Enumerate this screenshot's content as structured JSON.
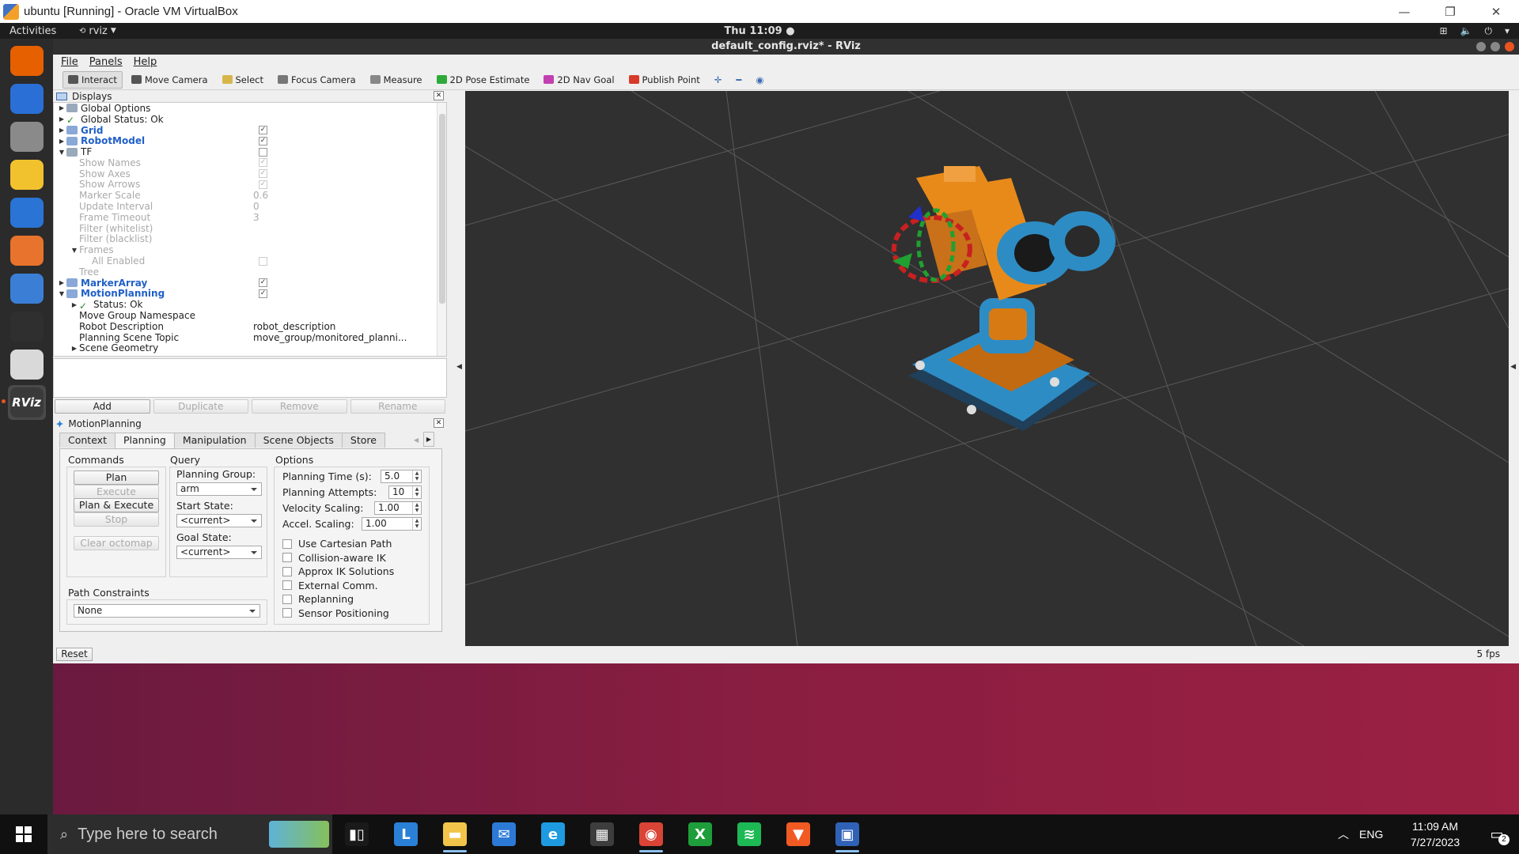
{
  "vbox": {
    "title": "ubuntu [Running] - Oracle VM VirtualBox",
    "minimize": "—",
    "restore": "❐",
    "close": "✕"
  },
  "ubuntu_bar": {
    "activities": "Activities",
    "app_name": "rviz",
    "clock": "Thu 11:09 ●"
  },
  "dock": {
    "items": [
      {
        "name": "firefox",
        "color": "#e66000"
      },
      {
        "name": "thunderbird",
        "color": "#2a6fd6"
      },
      {
        "name": "files",
        "color": "#8a8a8a"
      },
      {
        "name": "rhythmbox",
        "color": "#f2c12e"
      },
      {
        "name": "libreoffice-writer",
        "color": "#2a74d6"
      },
      {
        "name": "software",
        "color": "#e8732c"
      },
      {
        "name": "help",
        "color": "#3a7fd5"
      },
      {
        "name": "terminal",
        "color": "#2f2f2f"
      },
      {
        "name": "text-editor",
        "color": "#d9d9d9"
      },
      {
        "name": "rviz",
        "color": "#3a3a3a",
        "label": "RViz"
      }
    ]
  },
  "rviz": {
    "title": "default_config.rviz* - RViz",
    "menu": [
      "File",
      "Panels",
      "Help"
    ],
    "tools": [
      {
        "label": "Interact",
        "active": true,
        "color": "#555"
      },
      {
        "label": "Move Camera",
        "active": false,
        "color": "#555"
      },
      {
        "label": "Select",
        "active": false,
        "color": "#d6b64b"
      },
      {
        "label": "Focus Camera",
        "active": false,
        "color": "#777"
      },
      {
        "label": "Measure",
        "active": false,
        "color": "#888"
      },
      {
        "label": "2D Pose Estimate",
        "active": false,
        "color": "#2eaa3a"
      },
      {
        "label": "2D Nav Goal",
        "active": false,
        "color": "#c23fb0"
      },
      {
        "label": "Publish Point",
        "active": false,
        "color": "#d83a2a"
      }
    ],
    "displays": {
      "title": "Displays",
      "rows": [
        {
          "label": "Global Options",
          "arrow": "▶",
          "indent": 0,
          "style": "",
          "val": "",
          "check": null
        },
        {
          "label": "Global Status: Ok",
          "arrow": "▶",
          "indent": 0,
          "style": "",
          "val": "",
          "check": null,
          "icon": "✓"
        },
        {
          "label": "Grid",
          "arrow": "▶",
          "indent": 0,
          "style": "blue",
          "val": "",
          "check": "✓"
        },
        {
          "label": "RobotModel",
          "arrow": "▶",
          "indent": 0,
          "style": "blue",
          "val": "",
          "check": "✓"
        },
        {
          "label": "TF",
          "arrow": "▼",
          "indent": 0,
          "style": "",
          "val": "",
          "check": ""
        },
        {
          "label": "Show Names",
          "arrow": "",
          "indent": 1,
          "style": "dim",
          "val": "",
          "check": "✓"
        },
        {
          "label": "Show Axes",
          "arrow": "",
          "indent": 1,
          "style": "dim",
          "val": "",
          "check": "✓"
        },
        {
          "label": "Show Arrows",
          "arrow": "",
          "indent": 1,
          "style": "dim",
          "val": "",
          "check": "✓"
        },
        {
          "label": "Marker Scale",
          "arrow": "",
          "indent": 1,
          "style": "dim",
          "val": "0.6",
          "check": null
        },
        {
          "label": "Update Interval",
          "arrow": "",
          "indent": 1,
          "style": "dim",
          "val": "0",
          "check": null
        },
        {
          "label": "Frame Timeout",
          "arrow": "",
          "indent": 1,
          "style": "dim",
          "val": "3",
          "check": null
        },
        {
          "label": "Filter (whitelist)",
          "arrow": "",
          "indent": 1,
          "style": "dim",
          "val": "",
          "check": null
        },
        {
          "label": "Filter (blacklist)",
          "arrow": "",
          "indent": 1,
          "style": "dim",
          "val": "",
          "check": null
        },
        {
          "label": "Frames",
          "arrow": "▼",
          "indent": 1,
          "style": "dim",
          "val": "",
          "check": null
        },
        {
          "label": "All Enabled",
          "arrow": "",
          "indent": 2,
          "style": "dim",
          "val": "",
          "check": ""
        },
        {
          "label": "Tree",
          "arrow": "",
          "indent": 1,
          "style": "dim",
          "val": "",
          "check": null
        },
        {
          "label": "MarkerArray",
          "arrow": "▶",
          "indent": 0,
          "style": "blue",
          "val": "",
          "check": "✓"
        },
        {
          "label": "MotionPlanning",
          "arrow": "▼",
          "indent": 0,
          "style": "blue",
          "val": "",
          "check": "✓"
        },
        {
          "label": "Status: Ok",
          "arrow": "▶",
          "indent": 1,
          "style": "",
          "val": "",
          "check": null,
          "icon": "✓"
        },
        {
          "label": "Move Group Namespace",
          "arrow": "",
          "indent": 1,
          "style": "",
          "val": "",
          "check": null
        },
        {
          "label": "Robot Description",
          "arrow": "",
          "indent": 1,
          "style": "",
          "val": "robot_description",
          "check": null
        },
        {
          "label": "Planning Scene Topic",
          "arrow": "",
          "indent": 1,
          "style": "",
          "val": "move_group/monitored_planni...",
          "check": null
        },
        {
          "label": "Scene Geometry",
          "arrow": "▶",
          "indent": 1,
          "style": "",
          "val": "",
          "check": null
        }
      ],
      "buttons": [
        {
          "label": "Add",
          "disabled": false
        },
        {
          "label": "Duplicate",
          "disabled": true
        },
        {
          "label": "Remove",
          "disabled": true
        },
        {
          "label": "Rename",
          "disabled": true
        }
      ]
    },
    "motion_planning": {
      "title": "MotionPlanning",
      "tabs": [
        "Context",
        "Planning",
        "Manipulation",
        "Scene Objects",
        "Store"
      ],
      "active_tab": "Planning",
      "commands": {
        "title": "Commands",
        "plan": "Plan",
        "execute": "Execute",
        "plan_execute": "Plan & Execute",
        "stop": "Stop",
        "clear_octomap": "Clear octomap"
      },
      "query": {
        "title": "Query",
        "planning_group_label": "Planning Group:",
        "planning_group_value": "arm",
        "start_state_label": "Start State:",
        "start_state_value": "<current>",
        "goal_state_label": "Goal State:",
        "goal_state_value": "<current>"
      },
      "options": {
        "title": "Options",
        "planning_time_label": "Planning Time (s):",
        "planning_time_value": "5.0",
        "planning_attempts_label": "Planning Attempts:",
        "planning_attempts_value": "10",
        "velocity_scaling_label": "Velocity Scaling:",
        "velocity_scaling_value": "1.00",
        "accel_scaling_label": "Accel. Scaling:",
        "accel_scaling_value": "1.00",
        "checkboxes": [
          "Use Cartesian Path",
          "Collision-aware IK",
          "Approx IK Solutions",
          "External Comm.",
          "Replanning",
          "Sensor Positioning"
        ]
      },
      "path_constraints": {
        "title": "Path Constraints",
        "value": "None"
      }
    },
    "reset": "Reset",
    "fps": "5 fps",
    "colors": {
      "viewport_bg": "#303030",
      "grid": "#5a5a5a",
      "robot_orange": "#e88a1a",
      "robot_blue": "#2e8cc4"
    }
  },
  "taskbar": {
    "search_placeholder": "Type here to search",
    "apps": [
      {
        "name": "task-view",
        "color": "#1a1a1a",
        "glyph": "▮▯"
      },
      {
        "name": "lens",
        "color": "#2a80d6",
        "glyph": "L"
      },
      {
        "name": "file-explorer",
        "color": "#f2c54a",
        "glyph": "▬"
      },
      {
        "name": "mail",
        "color": "#2d7ad6",
        "glyph": "✉"
      },
      {
        "name": "edge",
        "color": "#1e9be0",
        "glyph": "e"
      },
      {
        "name": "store",
        "color": "#3d3d3d",
        "glyph": "▦"
      },
      {
        "name": "chrome",
        "color": "#d94436",
        "glyph": "◉"
      },
      {
        "name": "xbox",
        "color": "#1e9e3a",
        "glyph": "X"
      },
      {
        "name": "spotify",
        "color": "#1db954",
        "glyph": "≋"
      },
      {
        "name": "brave",
        "color": "#f25a24",
        "glyph": "▼"
      },
      {
        "name": "virtualbox",
        "color": "#2f62b6",
        "glyph": "▣"
      }
    ],
    "lang": "ENG",
    "time": "11:09 AM",
    "date": "7/27/2023",
    "notifications": "2"
  }
}
